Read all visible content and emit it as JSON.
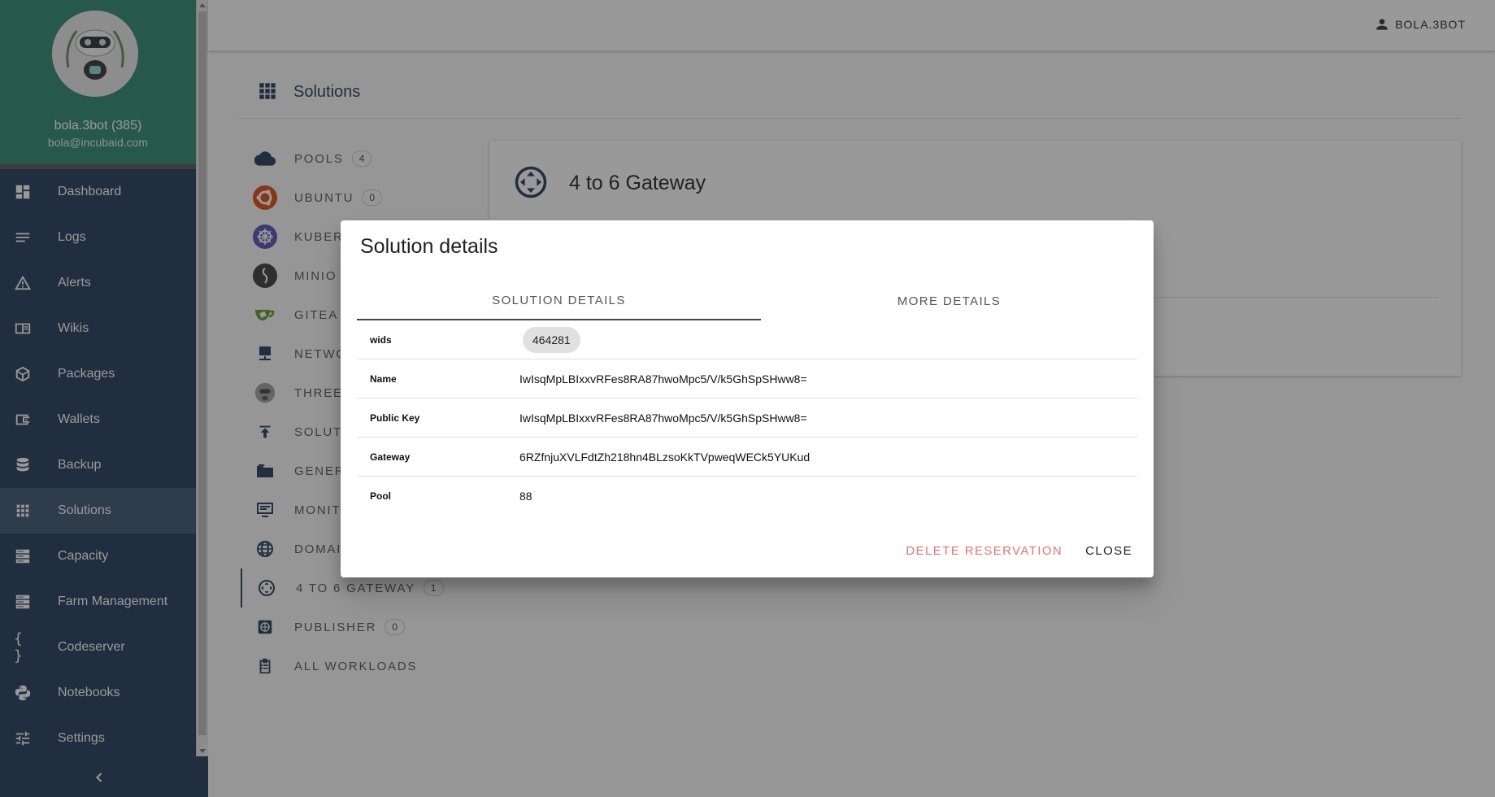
{
  "sidebar": {
    "user_name": "bola.3bot (385)",
    "user_email": "bola@incubaid.com",
    "items": [
      {
        "label": "Dashboard",
        "icon": "dashboard-icon"
      },
      {
        "label": "Logs",
        "icon": "logs-icon"
      },
      {
        "label": "Alerts",
        "icon": "alert-icon"
      },
      {
        "label": "Wikis",
        "icon": "wiki-icon"
      },
      {
        "label": "Packages",
        "icon": "package-icon"
      },
      {
        "label": "Wallets",
        "icon": "wallet-icon"
      },
      {
        "label": "Backup",
        "icon": "database-icon"
      },
      {
        "label": "Solutions",
        "icon": "apps-grid-icon",
        "active": true
      },
      {
        "label": "Capacity",
        "icon": "server-icon"
      },
      {
        "label": "Farm Management",
        "icon": "server-icon"
      },
      {
        "label": "Codeserver",
        "icon": "code-braces-icon"
      },
      {
        "label": "Notebooks",
        "icon": "python-icon"
      },
      {
        "label": "Settings",
        "icon": "sliders-icon"
      }
    ]
  },
  "topbar": {
    "user": "BOLA.3BOT"
  },
  "page": {
    "title": "Solutions"
  },
  "solutions_menu": [
    {
      "label": "POOLS",
      "count": "4",
      "icon": "cloud-icon"
    },
    {
      "label": "UBUNTU",
      "count": "0",
      "icon": "ubuntu-icon"
    },
    {
      "label": "KUBERI",
      "icon": "kubernetes-icon"
    },
    {
      "label": "MINIO",
      "icon": "minio-icon"
    },
    {
      "label": "GITEA",
      "icon": "gitea-icon"
    },
    {
      "label": "NETWO",
      "icon": "network-icon"
    },
    {
      "label": "THREE",
      "icon": "threebot-icon"
    },
    {
      "label": "SOLUTI",
      "icon": "upload-icon"
    },
    {
      "label": "GENER",
      "icon": "folder-icon"
    },
    {
      "label": "MONITO",
      "icon": "monitor-icon"
    },
    {
      "label": "DOMAIN",
      "icon": "globe-icon"
    },
    {
      "label": "4 TO 6 GATEWAY",
      "count": "1",
      "icon": "gateway-icon",
      "active": true
    },
    {
      "label": "PUBLISHER",
      "count": "0",
      "icon": "web-icon"
    },
    {
      "label": "ALL WORKLOADS",
      "icon": "clipboard-icon"
    }
  ],
  "card": {
    "title": "4 to 6 Gateway"
  },
  "dialog": {
    "title": "Solution details",
    "tabs": [
      "SOLUTION DETAILS",
      "MORE DETAILS"
    ],
    "rows": [
      {
        "label": "wids",
        "value": "464281",
        "chip": true
      },
      {
        "label": "Name",
        "value": "IwIsqMpLBIxxvRFes8RA87hwoMpc5/V/k5GhSpSHww8="
      },
      {
        "label": "Public Key",
        "value": "IwIsqMpLBIxxvRFes8RA87hwoMpc5/V/k5GhSpSHww8="
      },
      {
        "label": "Gateway",
        "value": "6RZfnjuXVLFdtZh218hn4BLzsoKkTVpweqWECk5YUKud"
      },
      {
        "label": "Pool",
        "value": "88"
      }
    ],
    "actions": {
      "delete": "DELETE RESERVATION",
      "close": "CLOSE"
    }
  },
  "colors": {
    "sidebar_bg": "#223a5a",
    "profile_bg": "#2e8a6e",
    "danger": "#e57373"
  }
}
